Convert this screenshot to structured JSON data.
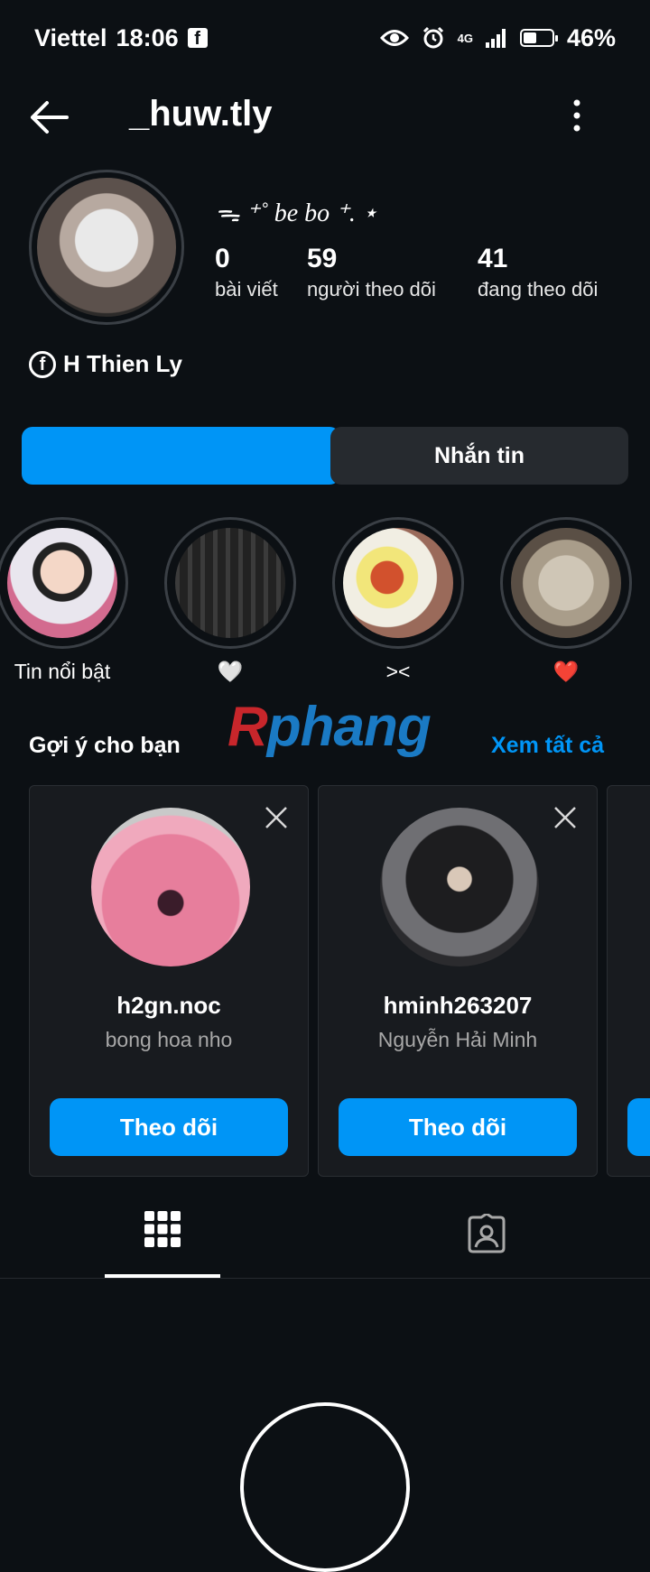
{
  "status_bar": {
    "carrier": "Viettel",
    "time": "18:06",
    "network": "4G",
    "battery": "46%",
    "battery_level": 0.46,
    "icons": [
      "facebook-icon",
      "eye-icon",
      "alarm-icon",
      "signal-icon",
      "battery-icon"
    ]
  },
  "header": {
    "username": "_huw.tly",
    "back_icon": "back-arrow-icon",
    "menu_icon": "more-vertical-icon"
  },
  "profile": {
    "nickname": "ᯓ ⁺˚ be bo ⁺. ⋆",
    "stats": [
      {
        "value": "0",
        "label": "bài viết"
      },
      {
        "value": "59",
        "label": "người theo dõi"
      },
      {
        "value": "41",
        "label": "đang theo dõi"
      }
    ],
    "facebook_name": "H Thien Ly"
  },
  "actions": {
    "primary_label": "",
    "message_label": "Nhắn tin"
  },
  "highlights": [
    {
      "label": "Tin nổi bật"
    },
    {
      "label": "🤍"
    },
    {
      "label": "><"
    },
    {
      "label": "❤️"
    }
  ],
  "watermark": {
    "part1": "R",
    "part2": "phang"
  },
  "suggestions": {
    "title": "Gợi ý cho bạn",
    "see_all": "Xem tất cả",
    "cards": [
      {
        "username": "h2gn.noc",
        "name": "bong hoa nho",
        "follow_label": "Theo dõi"
      },
      {
        "username": "hminh263207",
        "name": "Nguyễn Hải Minh",
        "follow_label": "Theo dõi"
      }
    ]
  },
  "tabs": {
    "items": [
      "grid-icon",
      "tagged-icon"
    ],
    "active": "grid-icon"
  },
  "colors": {
    "background": "#0c1014",
    "accent": "#0095f6",
    "secondary_button": "#262a2f"
  }
}
